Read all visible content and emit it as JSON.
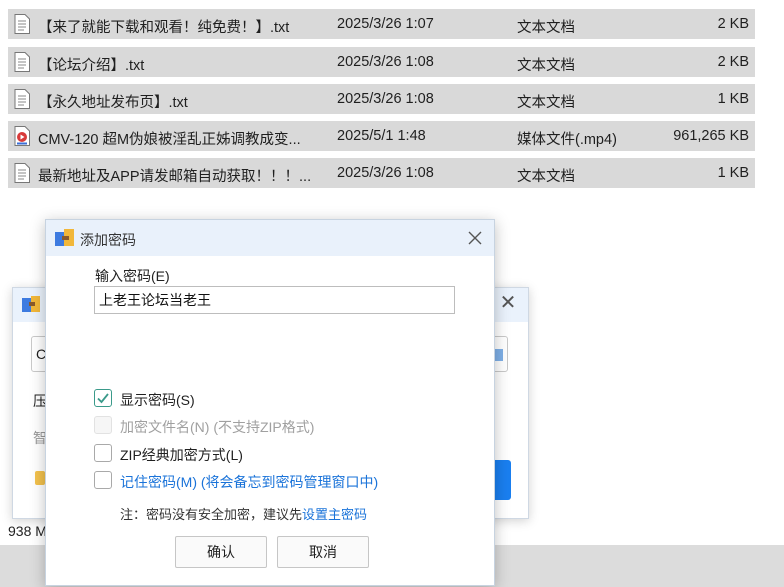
{
  "files": [
    {
      "name": "【来了就能下载和观看！纯免费！】.txt",
      "date": "2025/3/26 1:07",
      "type": "文本文档",
      "size": "2 KB",
      "icon": "text-file-icon"
    },
    {
      "name": "【论坛介绍】.txt",
      "date": "2025/3/26 1:08",
      "type": "文本文档",
      "size": "2 KB",
      "icon": "text-file-icon"
    },
    {
      "name": "【永久地址发布页】.txt",
      "date": "2025/3/26 1:08",
      "type": "文本文档",
      "size": "1 KB",
      "icon": "text-file-icon"
    },
    {
      "name": "CMV-120 超M伪娘被淫乱正姊调教成变...",
      "date": "2025/5/1 1:48",
      "type": "媒体文件(.mp4)",
      "size": "961,265 KB",
      "icon": "media-file-icon"
    },
    {
      "name": "最新地址及APP请发邮箱自动获取！！！...",
      "date": "2025/3/26 1:08",
      "type": "文本文档",
      "size": "1 KB",
      "icon": "text-file-icon"
    }
  ],
  "background_dialog": {
    "field_text": "C",
    "label1": "压",
    "label2": "智",
    "size_text": "938 M"
  },
  "dialog": {
    "title": "添加密码",
    "password_label": "输入密码(E)",
    "password_value": "上老王论坛当老王",
    "options": {
      "show_password": "显示密码(S)",
      "encrypt_filenames": "加密文件名(N) (不支持ZIP格式)",
      "zip_classic": "ZIP经典加密方式(L)",
      "remember_password": "记住密码(M) (将会备忘到密码管理窗口中)"
    },
    "note_prefix": "注：密码没有安全加密，建议先",
    "note_link": "设置主密码",
    "ok_label": "确认",
    "cancel_label": "取消"
  },
  "colors": {
    "row_bg": "#d9d9d9",
    "titlebar_bg": "#e9f1fb",
    "link": "#1a73d9",
    "check": "#3a9a8a",
    "accent_blue": "#1a7ff0"
  }
}
